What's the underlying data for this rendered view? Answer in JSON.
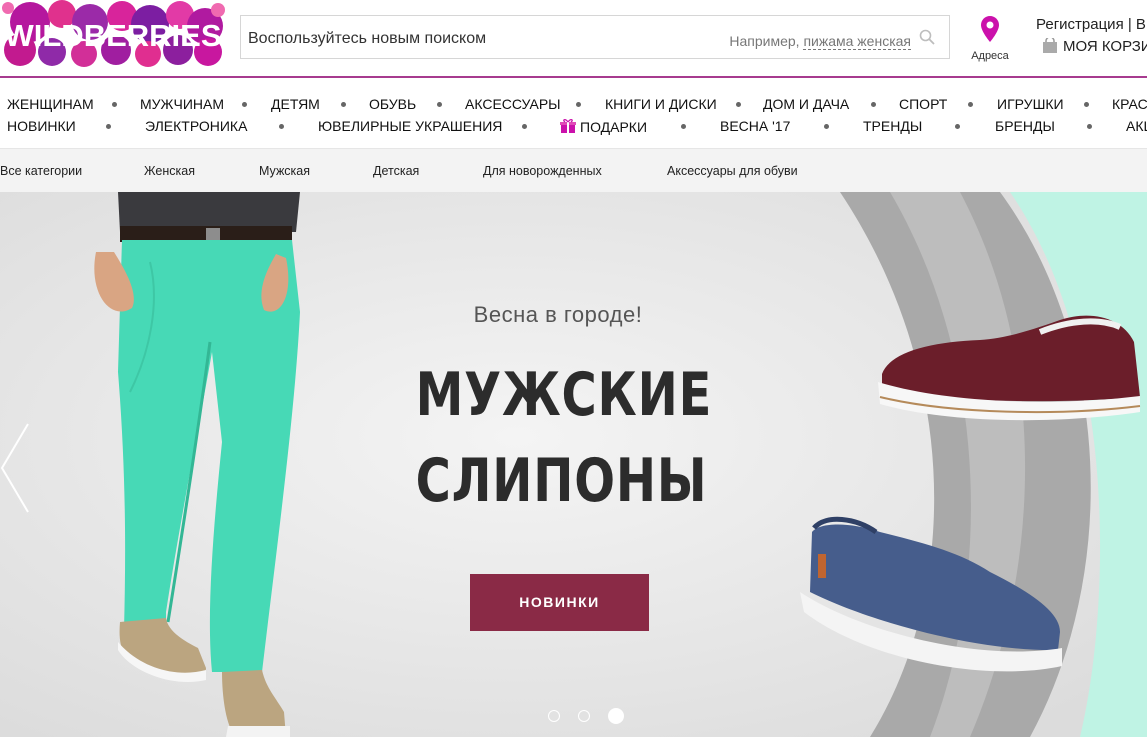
{
  "header": {
    "logo_text": "WILDBERRIES",
    "search": {
      "placeholder": "Воспользуйтесь новым поиском",
      "example_prefix": "Например,",
      "example_link": "пижама женская"
    },
    "address_label": "Адреса",
    "register_text": "Регистрация | В",
    "cart_text": "МОЯ КОРЗИ"
  },
  "nav": {
    "row1": [
      "ЖЕНЩИНАМ",
      "МУЖЧИНАМ",
      "ДЕТЯМ",
      "ОБУВЬ",
      "АКСЕССУАРЫ",
      "КНИГИ И ДИСКИ",
      "ДОМ И ДАЧА",
      "СПОРТ",
      "ИГРУШКИ",
      "КРАСО"
    ],
    "row2": [
      "НОВИНКИ",
      "ЭЛЕКТРОНИКА",
      "ЮВЕЛИРНЫЕ УКРАШЕНИЯ",
      "ПОДАРКИ",
      "ВЕСНА '17",
      "ТРЕНДЫ",
      "БРЕНДЫ",
      "АКЦ"
    ]
  },
  "subnav": [
    "Все категории",
    "Женская",
    "Мужская",
    "Детская",
    "Для новорожденных",
    "Аксессуары для обуви"
  ],
  "banner": {
    "tagline": "Весна в городе!",
    "headline_line1": "МУЖСКИЕ",
    "headline_line2": "СЛИПОНЫ",
    "cta_label": "НОВИНКИ",
    "slides_total": 3,
    "active_slide": 3
  },
  "colors": {
    "brand_purple": "#a73b8f",
    "brand_pink": "#cb11ab",
    "cta": "#8a2a46",
    "pants": "#47d9b6",
    "mint": "#bff3e4"
  }
}
